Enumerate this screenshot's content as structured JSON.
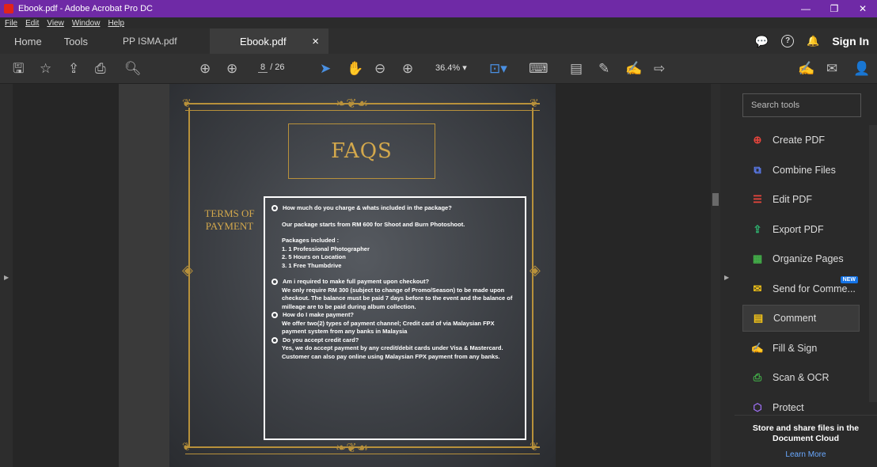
{
  "window": {
    "title": "Ebook.pdf - Adobe Acrobat Pro DC",
    "minimize": "—",
    "restore": "❐",
    "close": "✕"
  },
  "menu": [
    "File",
    "Edit",
    "View",
    "Window",
    "Help"
  ],
  "tabs": {
    "home": "Home",
    "tools": "Tools",
    "doc1": "PP ISMA.pdf",
    "doc2": "Ebook.pdf",
    "close": "×"
  },
  "header_right": {
    "sign_in": "Sign In"
  },
  "toolbar": {
    "current_page": "8",
    "total_pages": "/ 26",
    "zoom": "36.4%"
  },
  "page_content": {
    "heading": "FAQS",
    "side_label_line1": "TERMS OF",
    "side_label_line2": "PAYMENT",
    "q1": "How much do you charge & whats included in the package?",
    "a1": "Our package starts from RM 600 for Shoot and Burn Photoshoot.",
    "pkg_title": "Packages included :",
    "pkg1": "1. 1 Professional Photographer",
    "pkg2": "2. 5 Hours on Location",
    "pkg3": "3. 1 Free Thumbdrive",
    "q2": "Am i required to make full payment upon checkout?",
    "a2": "We only require RM 300 (subject to change of Promo/Season) to be made upon checkout. The balance must be paid 7 days before to the event and the balance of milleage are to be paid during album collection.",
    "q3": "How do I make payment?",
    "a3": "We offer two(2) types of payment channel; Credit card of via Malaysian FPX payment system from any banks in Malaysia",
    "q4": "Do you accept credit card?",
    "a4": "Yes, we do accept payment by any credit/debit cards under Visa & Mastercard. Customer can also pay online using Malaysian FPX payment from any banks."
  },
  "tools_pane": {
    "search_placeholder": "Search tools",
    "items": [
      {
        "label": "Create PDF",
        "color": "#e8453c"
      },
      {
        "label": "Combine Files",
        "color": "#5b7cf0"
      },
      {
        "label": "Edit PDF",
        "color": "#e8453c"
      },
      {
        "label": "Export PDF",
        "color": "#2eb872"
      },
      {
        "label": "Organize Pages",
        "color": "#43b049"
      },
      {
        "label": "Send for Comme...",
        "color": "#f5c518"
      },
      {
        "label": "Comment",
        "color": "#f5c518"
      },
      {
        "label": "Fill & Sign",
        "color": "#9b6ef0"
      },
      {
        "label": "Scan & OCR",
        "color": "#43b049"
      },
      {
        "label": "Protect",
        "color": "#9b6ef0"
      }
    ],
    "new_badge": "NEW",
    "cloud_title": "Store and share files in the Document Cloud",
    "learn_more": "Learn More"
  }
}
